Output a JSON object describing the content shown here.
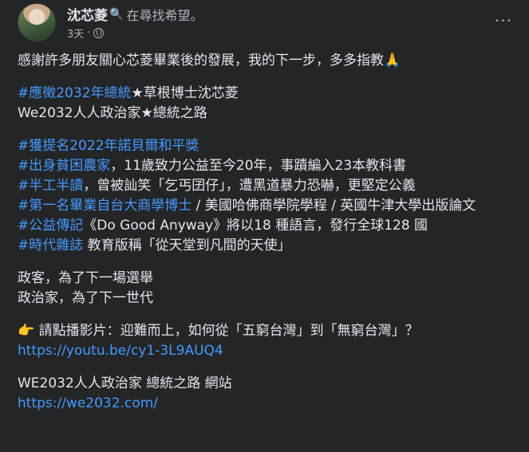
{
  "author": {
    "name": "沈芯菱",
    "status_emoji": "🔍",
    "status": "在尋找希望。",
    "time": "3天",
    "separator": "·"
  },
  "menu_icon_label": "···",
  "post": {
    "p1": "感謝許多朋友關心芯菱畢業後的發展，我的下一步，多多指教🙏",
    "p2_tag": "#應徵2032年總統",
    "p2_rest": "★草根博士沈芯菱",
    "p2_line2": "We2032人人政治家★總統之路",
    "p3": [
      {
        "tag": "#獲提名2022年諾貝爾和平獎",
        "text": ""
      },
      {
        "tag": "#出身貧困農家",
        "text": "，11歲致力公益至今20年，事蹟編入23本教科書"
      },
      {
        "tag": "#半工半讀",
        "text": "，曾被訕笑「乞丐囝仔」，遭黑道暴力恐嚇，更堅定公義"
      },
      {
        "tag": "#第一名畢業自台大商學博士",
        "text": " / 美國哈佛商學院學程 / 英國牛津大學出版論文"
      },
      {
        "tag": "#公益傳記",
        "text": "《Do Good Anyway》將以18 種語言，發行全球128 國"
      },
      {
        "tag": "#時代雜誌",
        "text": " 教育版稱「從天堂到凡間的天使」"
      }
    ],
    "p4_line1": "政客，為了下一場選舉",
    "p4_line2": "政治家，為了下一世代",
    "p5_icon": "👉",
    "p5_text": " 請點播影片：迎難而上，如何從「五窮台灣」到「無窮台灣」？",
    "p5_link": "https://youtu.be/cy1-3L9AUQ4",
    "p6_text": "WE2032人人政治家 總統之路 網站",
    "p6_link": "https://we2032.com/"
  }
}
